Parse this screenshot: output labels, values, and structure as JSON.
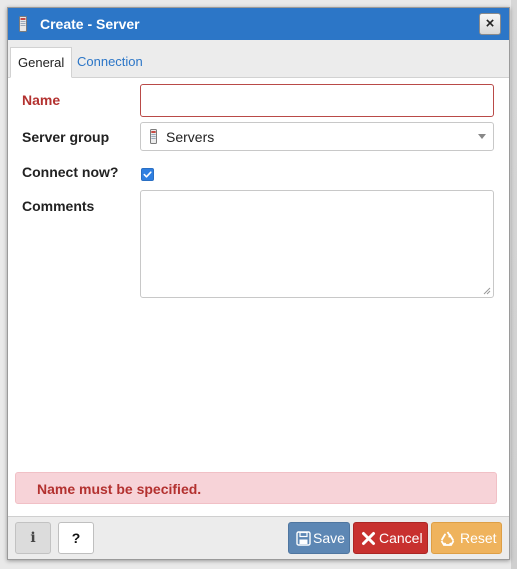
{
  "dialog": {
    "title": "Create - Server",
    "title_icon": "server-icon",
    "close_label": "×"
  },
  "tabs": [
    {
      "label": "General",
      "active": true
    },
    {
      "label": "Connection",
      "active": false
    }
  ],
  "form": {
    "name_label": "Name",
    "name_value": "",
    "server_group_label": "Server group",
    "server_group_value": "Servers",
    "connect_now_label": "Connect now?",
    "connect_now_checked": true,
    "comments_label": "Comments",
    "comments_value": ""
  },
  "error": {
    "message": "Name must be specified."
  },
  "footer": {
    "info_label": "i",
    "help_label": "?",
    "save_label": "Save",
    "cancel_label": "Cancel",
    "reset_label": "Reset"
  },
  "colors": {
    "titlebar": "#2c76c7",
    "error_text": "#b3312f",
    "error_bg": "#f7d3d8",
    "save": "#5d87b4",
    "cancel": "#c8312f",
    "reset": "#efb35d"
  }
}
